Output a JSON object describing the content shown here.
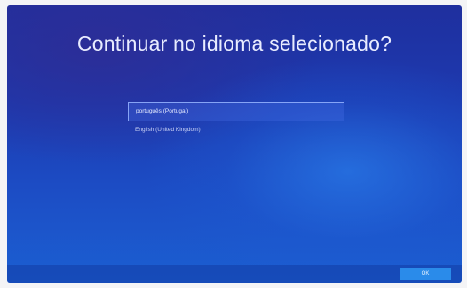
{
  "screen": {
    "title": "Continuar no idioma selecionado?"
  },
  "languages": [
    {
      "label": "português (Portugal)",
      "selected": true
    },
    {
      "label": "English (United Kingdom)",
      "selected": false
    }
  ],
  "footer": {
    "ok_label": "OK"
  },
  "colors": {
    "background_top": "#1f2f9e",
    "background_bottom": "#1b5fd2",
    "accent_button": "#2a8bea",
    "text": "#e8ecff"
  }
}
